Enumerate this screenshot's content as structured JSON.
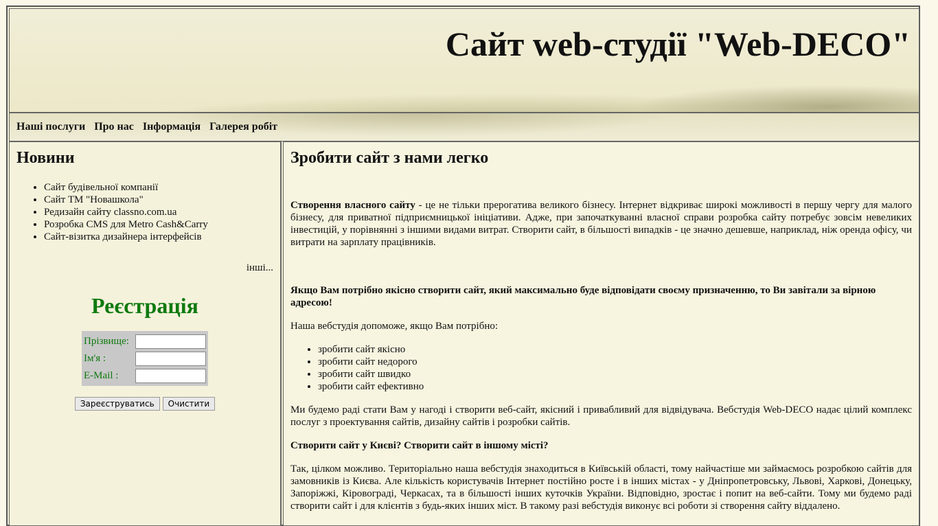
{
  "header": {
    "title": "Сайт web-студії \"Web-DECO\""
  },
  "nav": {
    "items": [
      "Наші послуги",
      "Про нас",
      "Інформація",
      "Галерея робіт"
    ]
  },
  "news": {
    "title": "Новини",
    "items": [
      "Сайт будівельної компанії",
      "Сайт ТМ \"Новашкола\"",
      "Редизайн сайту classno.com.ua",
      "Розробка CMS для Metro Cash&Carry",
      "Сайт-візитка дизайнера інтерфейсів"
    ],
    "more": "інші..."
  },
  "registration": {
    "title": "Реєстрація",
    "fields": [
      {
        "label": "Прізвище:",
        "value": ""
      },
      {
        "label": "Ім'я :",
        "value": ""
      },
      {
        "label": "E-Mail :",
        "value": ""
      }
    ],
    "submit": "Зареєструватись",
    "reset": "Очистити",
    "label_color": "#0f7a0f"
  },
  "main": {
    "title": "Зробити сайт з нами легко",
    "intro_bold": "Створення власного сайту",
    "intro_text": " - це не тільки прерогатива великого бізнесу. Інтернет відкриває широкі можливості в першу чергу для малого бізнесу, для приватної підприємницької ініціативи. Адже, при започаткуванні власної справи розробка сайту потребує зовсім невеликих інвестицій, у порівнянні з іншими видами витрат. Створити сайт, в більшості випадків - це значно дешевше, наприклад, ніж оренда офісу, чи витрати на зарплату працівників.",
    "callout": "Якщо Вам потрібно якісно створити сайт, який максимально буде відповідати своєму призначенню, то Ви завітали за вірною адресою!",
    "help_intro": "Наша вебстудія допоможе, якщо Вам потрібно:",
    "help_items": [
      "зробити сайт якісно",
      "зробити сайт недорого",
      "зробити сайт швидко",
      "зробити сайт ефективно"
    ],
    "offer": "Ми будемо раді стати Вам у нагоді і створити веб-сайт, якісний і привабливий для відвідувача. Вебстудія Web-DECO надає цілий комплекс послуг з проектування сайтів, дизайну сайтів і розробки сайтів.",
    "city_q": "Створити сайт у Києві? Створити сайт в іншому місті?",
    "city_text": "Так, цілком можливо. Територіально наша вебстудія знаходиться в Київській області, тому найчастіше ми займаємось розробкою сайтів для замовників із Києва. Але кількість користувачів Інтернет постійно росте і в інших містах - у Дніпропетровську, Львові, Харкові, Донецьку, Запоріжжі, Кіровограді, Черкасах, та в більшості інших куточків України. Відповідно, зростає і попит на веб-сайти. Тому ми будемо раді створити сайт і для клієнтів з будь-яких інших міст. В такому разі вебстудія виконує всі роботи зі створення сайту віддалено."
  }
}
